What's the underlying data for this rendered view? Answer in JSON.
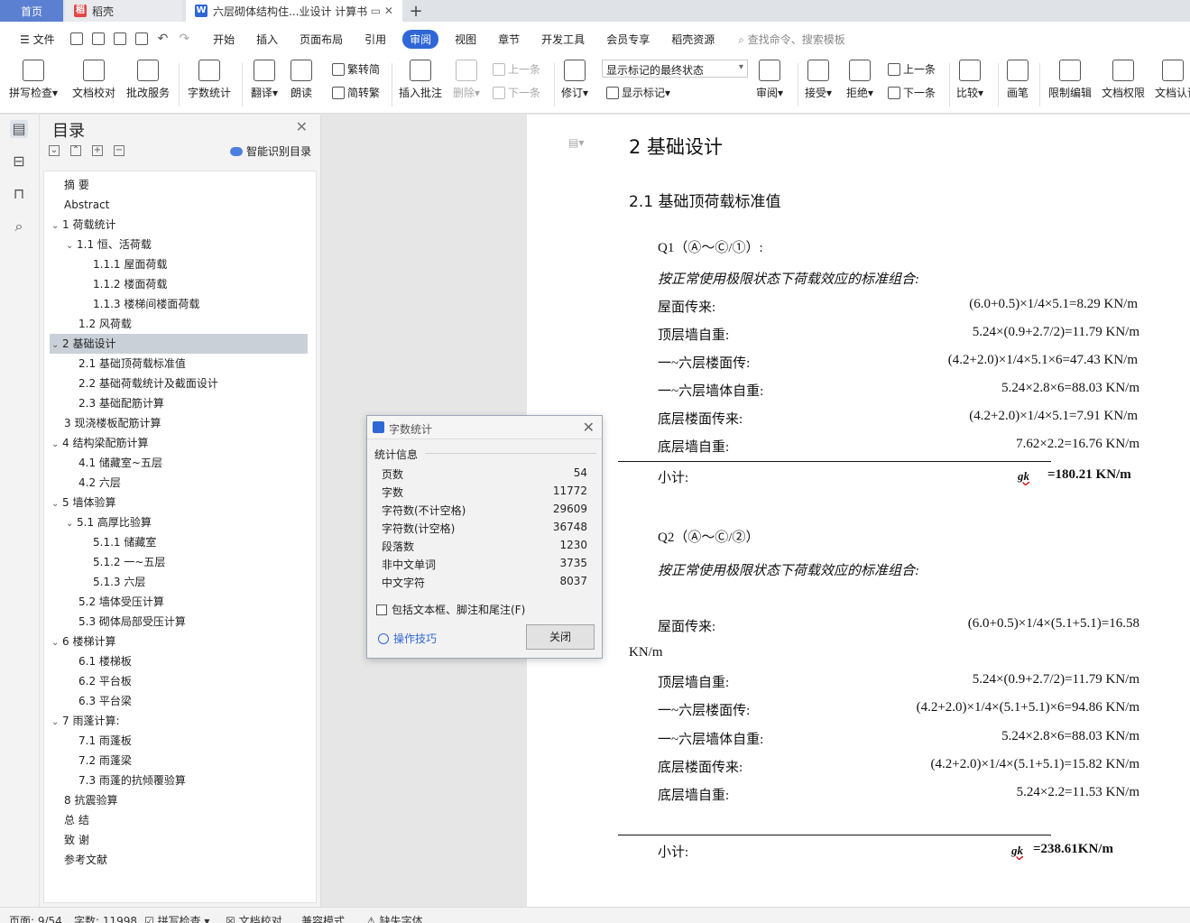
{
  "tabs": {
    "home": "首页",
    "daoke": "稻壳",
    "doc": "六层砌体结构住...业设计 计算书",
    "add": "+"
  },
  "menu": {
    "file": "文件",
    "items": [
      "开始",
      "插入",
      "页面布局",
      "引用",
      "审阅",
      "视图",
      "章节",
      "开发工具",
      "会员专享",
      "稻壳资源"
    ],
    "active": "审阅",
    "search": "查找命令、搜索模板"
  },
  "ribbon": {
    "spellcheck": "拼写检查",
    "doccheck": "文档校对",
    "review_service": "批改服务",
    "wordcount": "字数统计",
    "translate": "翻译",
    "read_aloud": "朗读",
    "trad": "繁转简",
    "simp": "简转繁",
    "insert_comment": "插入批注",
    "delete": "删除",
    "prev1": "上一条",
    "next1": "下一条",
    "track": "修订",
    "markup_dropdown": "显示标记的最终状态",
    "show_markup": "显示标记",
    "review": "审阅",
    "accept": "接受",
    "reject": "拒绝",
    "prev2": "上一条",
    "next2": "下一条",
    "compare": "比较",
    "pen": "画笔",
    "restrict": "限制编辑",
    "permission": "文档权限",
    "certify": "文档认证"
  },
  "toc": {
    "title": "目录",
    "smart": "智能识别目录",
    "items": [
      {
        "text": "摘    要",
        "level": 0,
        "arrow": ""
      },
      {
        "text": "Abstract",
        "level": 0,
        "arrow": ""
      },
      {
        "text": "1  荷载统计",
        "level": 0,
        "arrow": "v"
      },
      {
        "text": "1.1  恒、活荷载",
        "level": 1,
        "arrow": "v"
      },
      {
        "text": "1.1.1  屋面荷载",
        "level": 2,
        "arrow": ""
      },
      {
        "text": "1.1.2  楼面荷载",
        "level": 2,
        "arrow": ""
      },
      {
        "text": "1.1.3  楼梯间楼面荷载",
        "level": 2,
        "arrow": ""
      },
      {
        "text": "1.2  风荷载",
        "level": 1,
        "arrow": ""
      },
      {
        "text": "2  基础设计",
        "level": 0,
        "arrow": "v",
        "selected": true
      },
      {
        "text": "2.1  基础顶荷载标准值",
        "level": 1,
        "arrow": ""
      },
      {
        "text": "2.2  基础荷载统计及截面设计",
        "level": 1,
        "arrow": ""
      },
      {
        "text": "2.3  基础配筋计算",
        "level": 1,
        "arrow": ""
      },
      {
        "text": "3  现浇楼板配筋计算",
        "level": 0,
        "arrow": ""
      },
      {
        "text": "4  结构梁配筋计算",
        "level": 0,
        "arrow": "v"
      },
      {
        "text": "4.1  储藏室~五层",
        "level": 1,
        "arrow": ""
      },
      {
        "text": "4.2  六层",
        "level": 1,
        "arrow": ""
      },
      {
        "text": "5  墙体验算",
        "level": 0,
        "arrow": "v"
      },
      {
        "text": "5.1  高厚比验算",
        "level": 1,
        "arrow": "v"
      },
      {
        "text": "5.1.1  储藏室",
        "level": 2,
        "arrow": ""
      },
      {
        "text": "5.1.2  一~五层",
        "level": 2,
        "arrow": ""
      },
      {
        "text": "5.1.3  六层",
        "level": 2,
        "arrow": ""
      },
      {
        "text": "5.2  墙体受压计算",
        "level": 1,
        "arrow": ""
      },
      {
        "text": "5.3  砌体局部受压计算",
        "level": 1,
        "arrow": ""
      },
      {
        "text": "6  楼梯计算",
        "level": 0,
        "arrow": "v"
      },
      {
        "text": "6.1  楼梯板",
        "level": 1,
        "arrow": ""
      },
      {
        "text": "6.2  平台板",
        "level": 1,
        "arrow": ""
      },
      {
        "text": "6.3  平台梁",
        "level": 1,
        "arrow": ""
      },
      {
        "text": "7  雨蓬计算:",
        "level": 0,
        "arrow": "v"
      },
      {
        "text": "7.1  雨蓬板",
        "level": 1,
        "arrow": ""
      },
      {
        "text": "7.2  雨蓬梁",
        "level": 1,
        "arrow": ""
      },
      {
        "text": "7.3  雨蓬的抗倾覆验算",
        "level": 1,
        "arrow": ""
      },
      {
        "text": "8  抗震验算",
        "level": 0,
        "arrow": ""
      },
      {
        "text": "总    结",
        "level": 0,
        "arrow": ""
      },
      {
        "text": "致    谢",
        "level": 0,
        "arrow": ""
      },
      {
        "text": "参考文献",
        "level": 0,
        "arrow": ""
      }
    ]
  },
  "doc": {
    "h1": "2  基础设计",
    "h2": "2.1  基础顶荷载标准值",
    "q1": "Q1（Ⓐ～Ⓒ/①）:",
    "q1_note": "按正常使用极限状态下荷载效应的标准组合:",
    "q1_rows": [
      {
        "label": "屋面传来:",
        "value": "(6.0+0.5)×1/4×5.1=8.29 KN/m"
      },
      {
        "label": "顶层墙自重:",
        "value": "5.24×(0.9+2.7/2)=11.79 KN/m"
      },
      {
        "label": "一~六层楼面传:",
        "value": "(4.2+2.0)×1/4×5.1×6=47.43 KN/m"
      },
      {
        "label": "一~六层墙体自重:",
        "value": "5.24×2.8×6=88.03 KN/m"
      },
      {
        "label": "底层楼面传来:",
        "value": "(4.2+2.0)×1/4×5.1=7.91 KN/m"
      },
      {
        "label": "底层墙自重:",
        "value": "7.62×2.2=16.76 KN/m"
      }
    ],
    "q1_sum_label": "小计:",
    "q1_sum_gk": "gk",
    "q1_sum": "=180.21 KN/m",
    "q2": "Q2（Ⓐ～Ⓒ/②）",
    "q2_note": "按正常使用极限状态下荷载效应的标准组合:",
    "q2_row1_label": "屋面传来:",
    "q2_row1_value": "(6.0+0.5)×1/4×(5.1+5.1)=16.58",
    "q2_row1_wrap": "KN/m",
    "q2_rows": [
      {
        "label": "顶层墙自重:",
        "value": "5.24×(0.9+2.7/2)=11.79 KN/m"
      },
      {
        "label": "一~六层楼面传:",
        "value": "(4.2+2.0)×1/4×(5.1+5.1)×6=94.86 KN/m"
      },
      {
        "label": "一~六层墙体自重:",
        "value": "5.24×2.8×6=88.03 KN/m"
      },
      {
        "label": "底层楼面传来:",
        "value": "(4.2+2.0)×1/4×(5.1+5.1)=15.82 KN/m"
      },
      {
        "label": "底层墙自重:",
        "value": "5.24×2.2=11.53 KN/m"
      }
    ],
    "q2_sum_label": "小计:",
    "q2_sum_gk": "gk",
    "q2_sum": "=238.61KN/m"
  },
  "dialog": {
    "title": "字数统计",
    "group": "统计信息",
    "stats": [
      {
        "label": "页数",
        "value": "54"
      },
      {
        "label": "字数",
        "value": "11772"
      },
      {
        "label": "字符数(不计空格)",
        "value": "29609"
      },
      {
        "label": "字符数(计空格)",
        "value": "36748"
      },
      {
        "label": "段落数",
        "value": "1230"
      },
      {
        "label": "非中文单词",
        "value": "3735"
      },
      {
        "label": "中文字符",
        "value": "8037"
      }
    ],
    "checkbox": "包括文本框、脚注和尾注(F)",
    "tips": "操作技巧",
    "close": "关闭"
  },
  "status": {
    "page": "页面: 9/54",
    "words": "字数: 11998",
    "spell": "拼写检查",
    "doccheck": "文档校对",
    "compat": "兼容模式",
    "font": "缺失字体"
  }
}
